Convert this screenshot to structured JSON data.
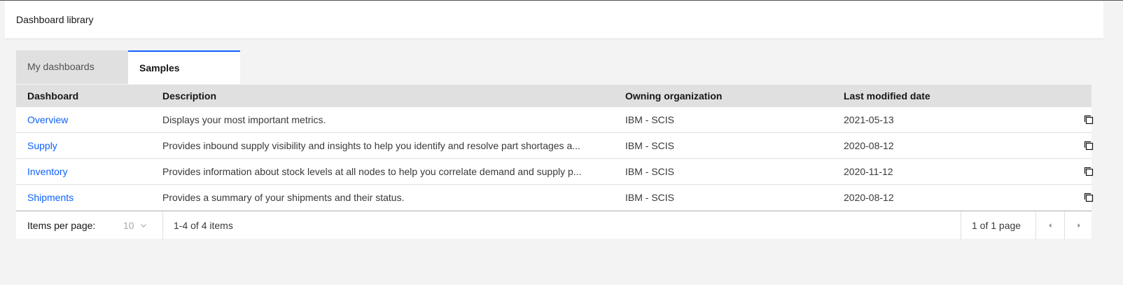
{
  "header": {
    "title": "Dashboard library"
  },
  "tabs": [
    {
      "label": "My dashboards",
      "active": false
    },
    {
      "label": "Samples",
      "active": true
    }
  ],
  "table": {
    "columns": [
      "Dashboard",
      "Description",
      "Owning organization",
      "Last modified date"
    ],
    "rows": [
      {
        "name": "Overview",
        "description": "Displays your most important metrics.",
        "org": "IBM - SCIS",
        "date": "2021-05-13",
        "action_icon": "copy-icon"
      },
      {
        "name": "Supply",
        "description": "Provides inbound supply visibility and insights to help you identify and resolve part shortages a...",
        "org": "IBM - SCIS",
        "date": "2020-08-12",
        "action_icon": "copy-icon"
      },
      {
        "name": "Inventory",
        "description": "Provides information about stock levels at all nodes to help you correlate demand and supply p...",
        "org": "IBM - SCIS",
        "date": "2020-11-12",
        "action_icon": "copy-icon"
      },
      {
        "name": "Shipments",
        "description": "Provides a summary of your shipments and their status.",
        "org": "IBM - SCIS",
        "date": "2020-08-12",
        "action_icon": "copy-icon"
      }
    ]
  },
  "pagination": {
    "items_per_page_label": "Items per page:",
    "items_per_page_value": "10",
    "range_text": "1-4 of 4 items",
    "pages_text": "1 of 1 page",
    "prev_icon": "caret-left-icon",
    "next_icon": "caret-right-icon"
  },
  "colors": {
    "accent": "#0f62fe",
    "page_bg": "#f3f3f3",
    "header_row_bg": "#e0e0e0"
  }
}
